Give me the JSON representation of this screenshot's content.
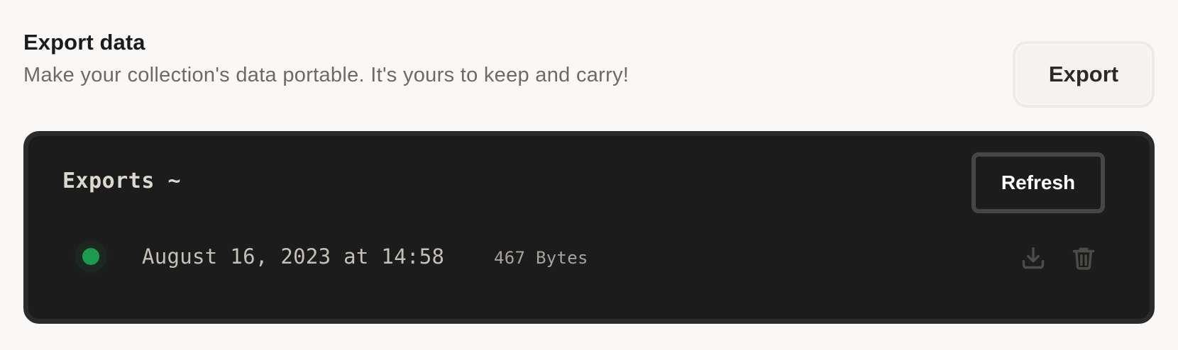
{
  "header": {
    "title": "Export data",
    "description": "Make your collection's data portable. It's yours to keep and carry!",
    "export_button_label": "Export"
  },
  "exports_panel": {
    "title": "Exports ~",
    "refresh_button_label": "Refresh",
    "items": [
      {
        "status": "completed",
        "status_color": "#1d9a4f",
        "date": "August 16, 2023 at 14:58",
        "size": "467 Bytes",
        "actions": [
          "download-icon",
          "trash-icon"
        ]
      }
    ]
  },
  "colors": {
    "background": "#f9f8f6",
    "panel_background": "#1c1c1c",
    "status_green": "#1d9a4f"
  }
}
